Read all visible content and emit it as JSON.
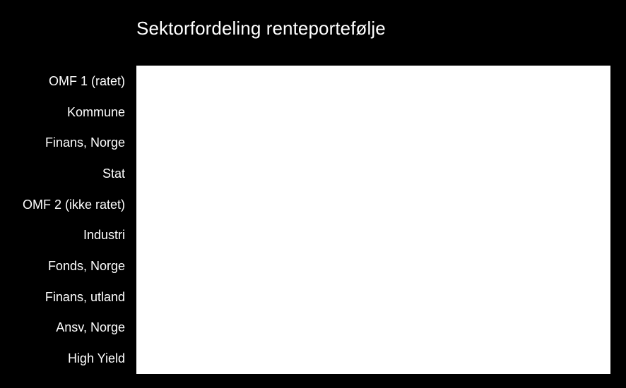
{
  "chart": {
    "title": "Sektorfordeling renteportefølje",
    "background_color": "#000000",
    "plot_background_color": "#ffffff",
    "text_color": "#ffffff"
  },
  "chart_data": {
    "type": "bar",
    "orientation": "horizontal",
    "title": "Sektorfordeling renteportefølje",
    "xlabel": "",
    "ylabel": "",
    "grid": false,
    "legend": false,
    "categories": [
      "OMF 1 (ratet)",
      "Kommune",
      "Finans, Norge",
      "Stat",
      "OMF 2 (ikke ratet)",
      "Industri",
      "Fonds, Norge",
      "Finans, utland",
      "Ansv, Norge",
      "High Yield"
    ],
    "values": [
      null,
      null,
      null,
      null,
      null,
      null,
      null,
      null,
      null,
      null
    ],
    "note": "Plot area is rendered blank white; no bars, gridlines, tick labels or value labels are visible in the screenshot."
  }
}
